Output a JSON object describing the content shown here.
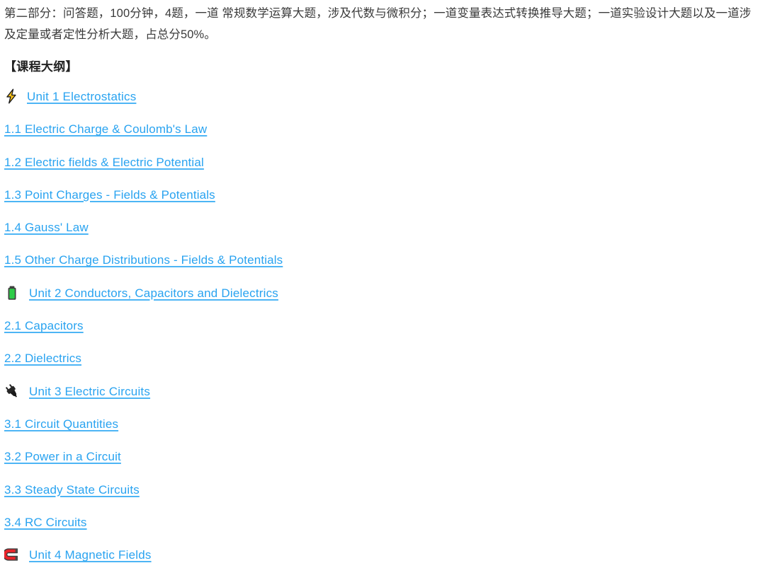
{
  "document": {
    "intro_paragraph": "第二部分：问答题，100分钟，4题，一道 常规数学运算大题，涉及代数与微积分；一道变量表达式转换推导大题；一道实验设计大题以及一道涉及定量或者定性分析大题，占总分50%。",
    "section_heading": "【课程大纲】",
    "colors": {
      "link": "#29a3f0",
      "link_underline": "#4db5f5",
      "body_text": "#3a3a3a",
      "heading_text": "#222222",
      "background": "#ffffff"
    }
  },
  "outline": {
    "units": [
      {
        "icon": "high-voltage-icon",
        "title": "Unit 1 Electrostatics",
        "lessons": [
          "1.1 Electric Charge & Coulomb's Law",
          "1.2 Electric fields & Electric Potential",
          "1.3 Point Charges - Fields & Potentials",
          "1.4 Gauss' Law",
          "1.5 Other Charge Distributions - Fields & Potentials"
        ]
      },
      {
        "icon": "battery-icon",
        "title": "Unit 2 Conductors, Capacitors and Dielectrics",
        "lessons": [
          "2.1 Capacitors",
          "2.2 Dielectrics"
        ]
      },
      {
        "icon": "electric-plug-icon",
        "title": "Unit 3 Electric Circuits",
        "lessons": [
          "3.1 Circuit Quantities",
          "3.2 Power in a Circuit",
          "3.3 Steady State Circuits",
          "3.4 RC Circuits"
        ]
      },
      {
        "icon": "magnet-icon",
        "title": "Unit 4 Magnetic Fields",
        "lessons": []
      }
    ]
  }
}
